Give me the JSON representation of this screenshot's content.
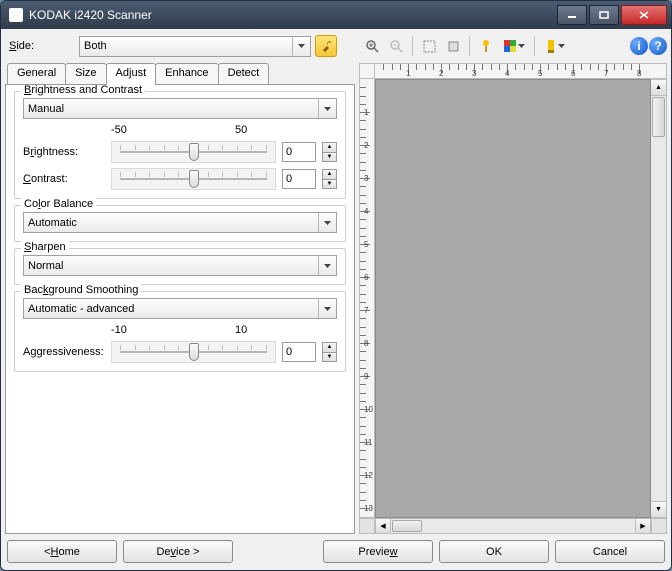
{
  "window": {
    "title": "KODAK i2420 Scanner"
  },
  "side": {
    "label": "Side:",
    "value": "Both"
  },
  "tabs": [
    "General",
    "Size",
    "Adjust",
    "Enhance",
    "Detect"
  ],
  "active_tab": "Adjust",
  "brightness_contrast": {
    "title": "Brightness and Contrast",
    "mode": "Manual",
    "range_min": "-50",
    "range_max": "50",
    "brightness_label": "Brightness:",
    "brightness_value": "0",
    "contrast_label": "Contrast:",
    "contrast_value": "0"
  },
  "color_balance": {
    "title": "Color Balance",
    "value": "Automatic"
  },
  "sharpen": {
    "title": "Sharpen",
    "value": "Normal"
  },
  "background_smoothing": {
    "title": "Background Smoothing",
    "mode": "Automatic - advanced",
    "range_min": "-10",
    "range_max": "10",
    "aggr_label": "Aggressiveness:",
    "aggr_value": "0"
  },
  "ruler_h": [
    "1",
    "2",
    "3",
    "4",
    "5",
    "6",
    "7",
    "8"
  ],
  "ruler_v": [
    "1",
    "2",
    "3",
    "4",
    "5",
    "6",
    "7",
    "8",
    "9",
    "10",
    "11",
    "12",
    "13"
  ],
  "buttons": {
    "home": "< Home",
    "device": "Device >",
    "preview": "Preview",
    "ok": "OK",
    "cancel": "Cancel"
  },
  "icons": {
    "zoom_in": "zoom-in-icon",
    "zoom_out": "zoom-out-icon",
    "region1": "region-icon",
    "region2": "select-icon",
    "pin": "pin-icon",
    "color": "color-icon",
    "highlight": "highlight-icon",
    "info": "i",
    "help": "?"
  }
}
